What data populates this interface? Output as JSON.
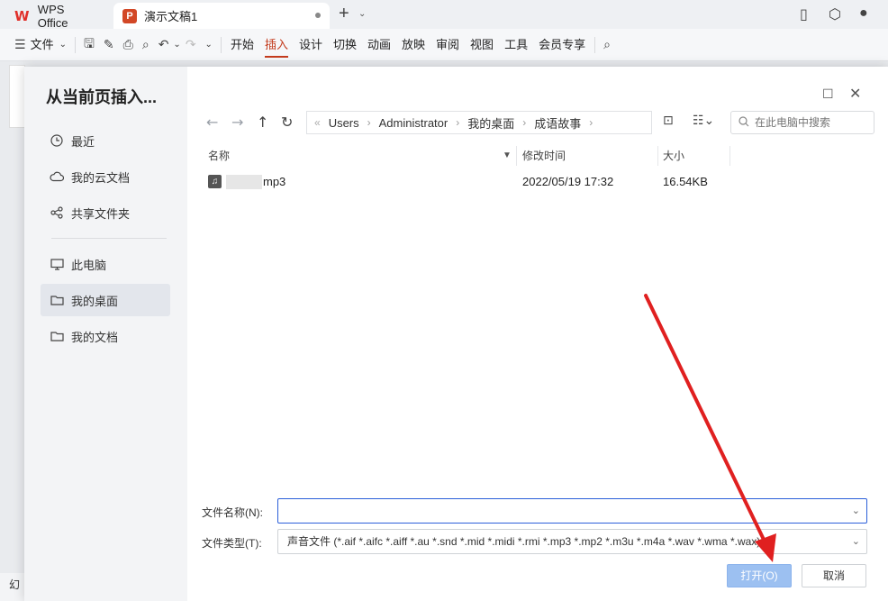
{
  "titlebar": {
    "app_tab": "WPS Office",
    "doc_tab": "演示文稿1",
    "ppt_letter": "P"
  },
  "ribbon": {
    "file_menu": "文件",
    "tabs": [
      "开始",
      "插入",
      "设计",
      "切换",
      "动画",
      "放映",
      "审阅",
      "视图",
      "工具",
      "会员专享"
    ],
    "active_tab": "插入"
  },
  "background": {
    "bottom_text": "幻"
  },
  "dialog": {
    "title": "从当前页插入...",
    "sidebar": {
      "items": [
        {
          "label": "最近",
          "icon": "clock-icon"
        },
        {
          "label": "我的云文档",
          "icon": "cloud-icon"
        },
        {
          "label": "共享文件夹",
          "icon": "share-icon"
        },
        {
          "label": "此电脑",
          "icon": "monitor-icon"
        },
        {
          "label": "我的桌面",
          "icon": "folder-icon",
          "active": true
        },
        {
          "label": "我的文档",
          "icon": "folder-icon"
        }
      ]
    },
    "breadcrumb": [
      "Users",
      "Administrator",
      "我的桌面",
      "成语故事"
    ],
    "search_placeholder": "在此电脑中搜索",
    "columns": {
      "name": "名称",
      "modified": "修改时间",
      "size": "大小"
    },
    "files": [
      {
        "name_suffix": "mp3",
        "modified": "2022/05/19 17:32",
        "size": "16.54KB"
      }
    ],
    "filename_label": "文件名称(N):",
    "filename_value": "",
    "filetype_label": "文件类型(T):",
    "filetype_value": "声音文件 (*.aif *.aifc *.aiff *.au *.snd *.mid *.midi *.rmi *.mp3 *.mp2 *.m3u *.m4a *.wav *.wma *.wax)",
    "open_button": "打开(O)",
    "cancel_button": "取消"
  },
  "colors": {
    "accent": "#c43c1e",
    "open_button_bg": "#9cc0f1",
    "focus_border": "#2b5fd9",
    "annotation_arrow": "#e02020"
  }
}
